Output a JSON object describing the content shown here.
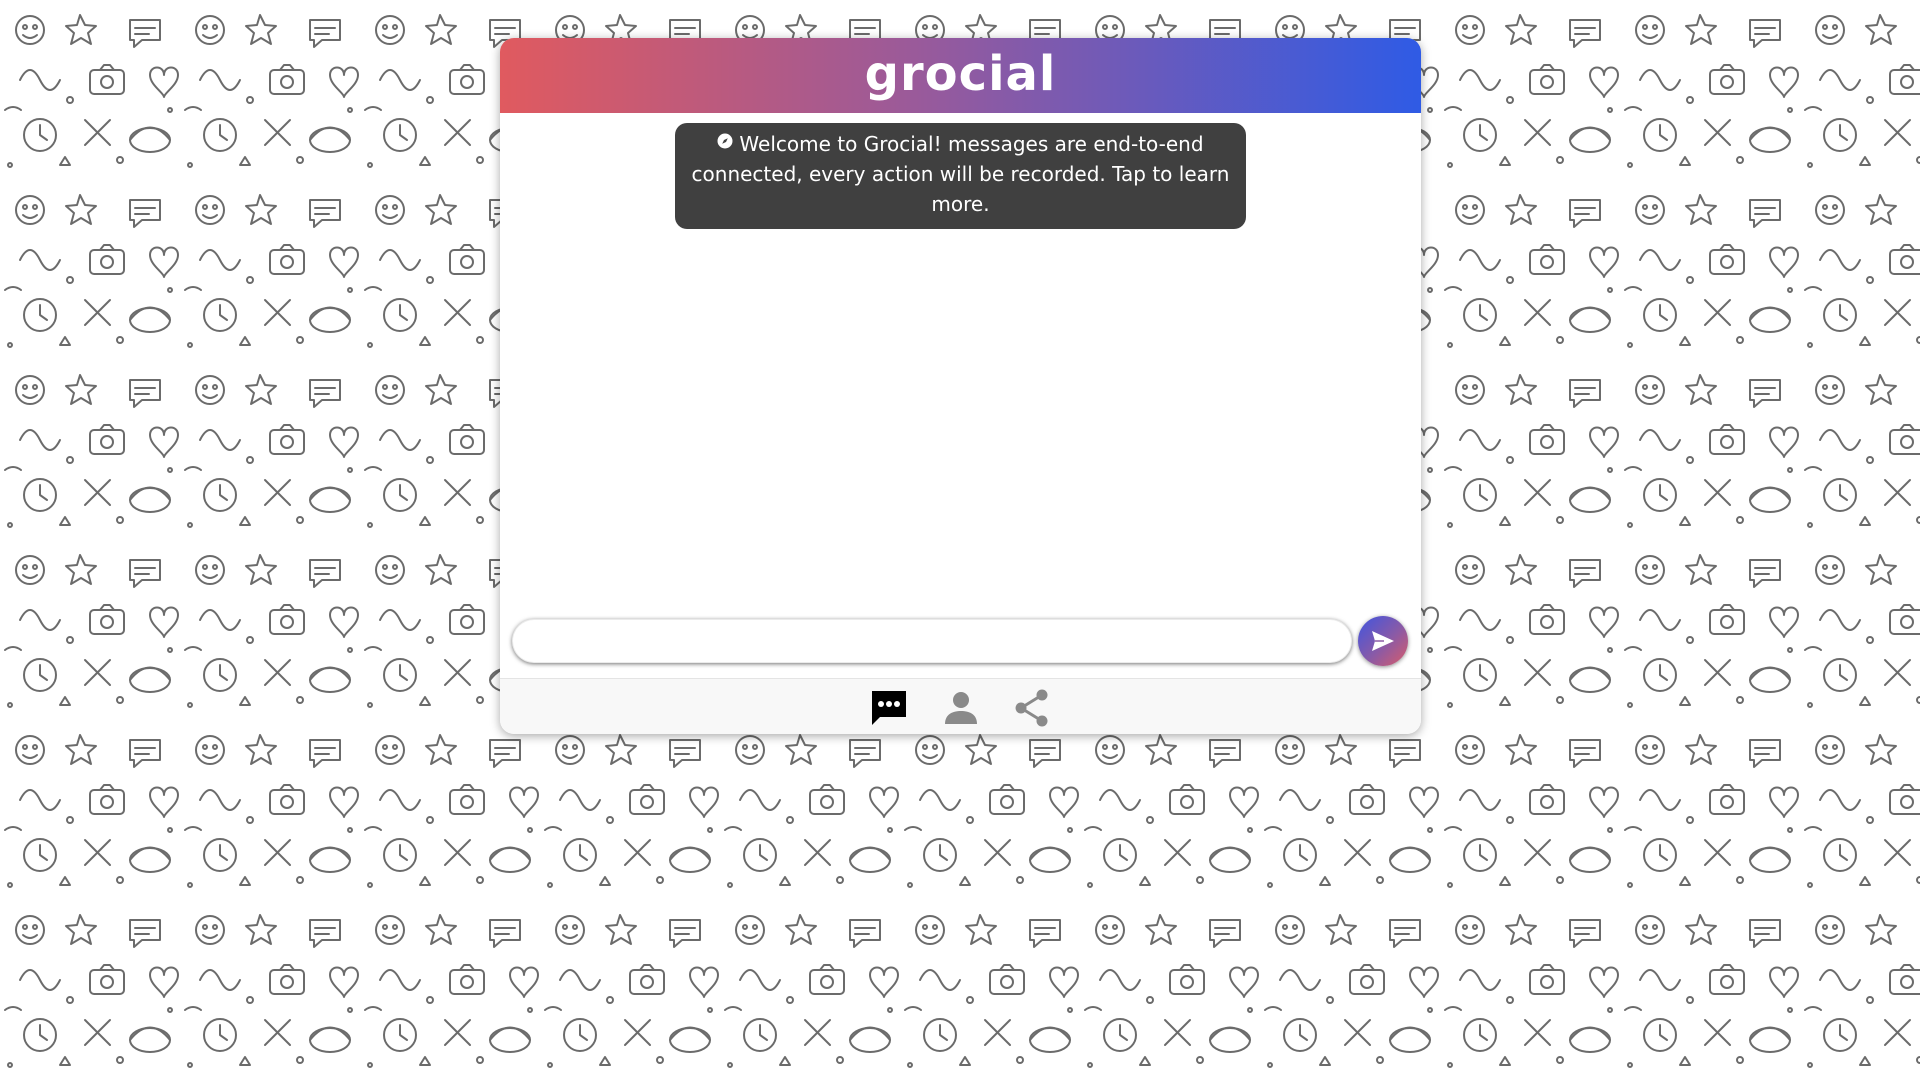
{
  "app": {
    "brand": "grocial"
  },
  "welcome": {
    "icon": "compass-info-icon",
    "text": "Welcome to Grocial! messages are end-to-end connected, every action will be recorded. Tap to learn more."
  },
  "composer": {
    "input_value": "",
    "placeholder": "",
    "send_icon": "send-icon"
  },
  "nav": {
    "items": [
      {
        "icon": "chat-bubble-icon",
        "active": true,
        "color": "#000000"
      },
      {
        "icon": "person-icon",
        "active": false,
        "color": "#8a8a8a"
      },
      {
        "icon": "share-icon",
        "active": false,
        "color": "#8a8a8a"
      }
    ]
  },
  "colors": {
    "header_gradient_start": "#e05a5f",
    "header_gradient_end": "#2f5be5",
    "toast_bg": "#404040"
  }
}
